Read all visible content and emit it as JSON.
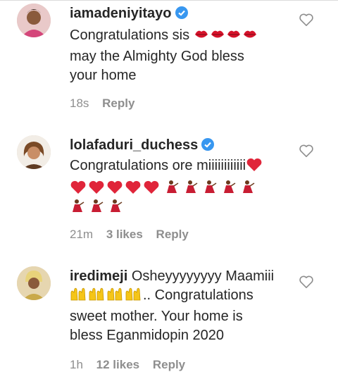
{
  "comments": [
    {
      "username": "iamadeniyitayo",
      "verified": true,
      "lines": [
        "Congratulations sis",
        "may the Almighty God bless",
        "your home"
      ],
      "line1_emoji": [
        "kiss-lips-icon",
        "kiss-lips-icon",
        "kiss-lips-icon",
        "kiss-lips-icon"
      ],
      "time": "18s",
      "likes": "",
      "reply": "Reply"
    },
    {
      "username": "lolafaduri_duchess",
      "verified": true,
      "lines": [
        "Congratulations ore miiiiiiiiiiii"
      ],
      "time": "21m",
      "likes": "3 likes",
      "reply": "Reply"
    },
    {
      "username": "iredimeji",
      "verified": false,
      "first_text": "Osheyyyyyyyy Maamiii",
      "lines": [
        ".. Congratulations",
        "sweet mother. Your home is",
        "bless Eganmidopin 2020"
      ],
      "time": "1h",
      "likes": "12 likes",
      "reply": "Reply"
    }
  ],
  "colors": {
    "verified": "#3897f0",
    "meta": "#8e8e8e",
    "text": "#262626",
    "heart": "red",
    "kiss": "#d6132b",
    "dancer": "#e0253a",
    "clap": "#f5c518"
  },
  "icons": {
    "like": "heart-outline-icon",
    "verified": "verified-badge-icon"
  }
}
